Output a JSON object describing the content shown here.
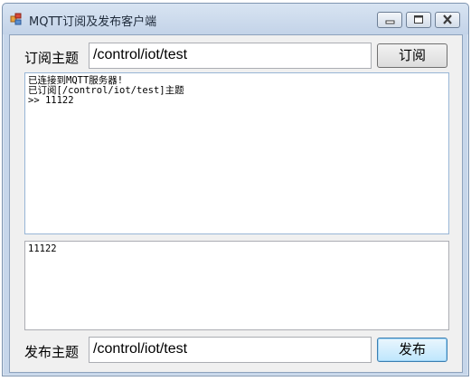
{
  "window": {
    "title": "MQTT订阅及发布客户端",
    "icon": "app-window-icon",
    "controls": [
      "minimize-icon",
      "maximize-icon",
      "close-icon"
    ]
  },
  "subscribe": {
    "label": "订阅主题",
    "topic_value": "/control/iot/test",
    "button_label": "订阅"
  },
  "log": {
    "lines": [
      "已连接到MQTT服务器!",
      "已订阅[/control/iot/test]主题",
      ">> 11122"
    ]
  },
  "message": {
    "value": "11122"
  },
  "publish": {
    "label": "发布主题",
    "topic_value": "/control/iot/test",
    "button_label": "发布"
  },
  "colors": {
    "titlebar": "#c3d3e8",
    "client_bg": "#f0f0f0",
    "focus_button": "#bee6fd"
  }
}
